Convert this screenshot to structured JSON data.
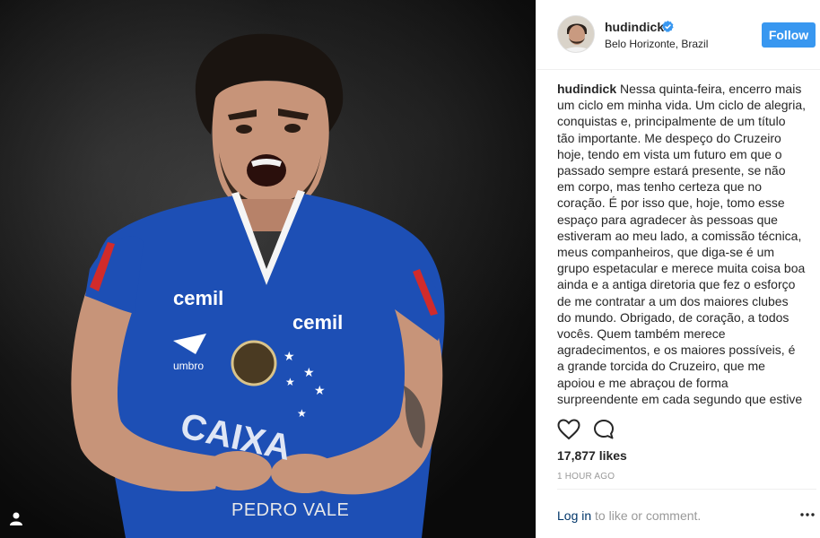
{
  "post": {
    "watermark": "PEDRO VALE",
    "photo_subject": "player-in-blue-jersey"
  },
  "header": {
    "username": "hudindick",
    "location": "Belo Horizonte, Brazil",
    "follow_label": "Follow"
  },
  "caption": {
    "username": "hudindick",
    "text": "Nessa quinta-feira, encerro mais um ciclo em minha vida. Um ciclo de alegria, conquistas e, principalmente de um título tão importante. Me despeço do Cruzeiro hoje, tendo em vista um futuro em que o passado sempre estará presente, se não em corpo, mas tenho certeza que no coração. É por isso que, hoje, tomo esse espaço para agradecer às pessoas que estiveram ao meu lado, a comissão técnica, meus companheiros, que diga-se é um grupo espetacular e merece muita coisa boa ainda e a antiga diretoria que fez o esforço de me contratar a um dos maiores clubes do mundo. Obrigado, de coração, a todos vocês. Quem também merece agradecimentos, e os maiores possíveis, é a grande torcida do Cruzeiro, que me apoiou e me abraçou de forma surpreendente em cada segundo que estive em campo e fora dele, também sentirei falta de vocês. Meu"
  },
  "stats": {
    "likes": "17,877 likes",
    "timestamp": "1 HOUR AGO"
  },
  "comment_bar": {
    "login_link": "Log in",
    "login_rest": " to like or comment."
  },
  "icons": {
    "verified": "verified-badge-icon",
    "like": "heart-icon",
    "comment": "comment-bubble-icon",
    "more": "more-options-icon",
    "user_tag": "user-tag-icon"
  },
  "colors": {
    "follow_button": "#3897f0",
    "verified": "#3897f0",
    "login_link": "#003569",
    "muted_text": "#999999",
    "jersey_blue": "#1d4fb5"
  }
}
